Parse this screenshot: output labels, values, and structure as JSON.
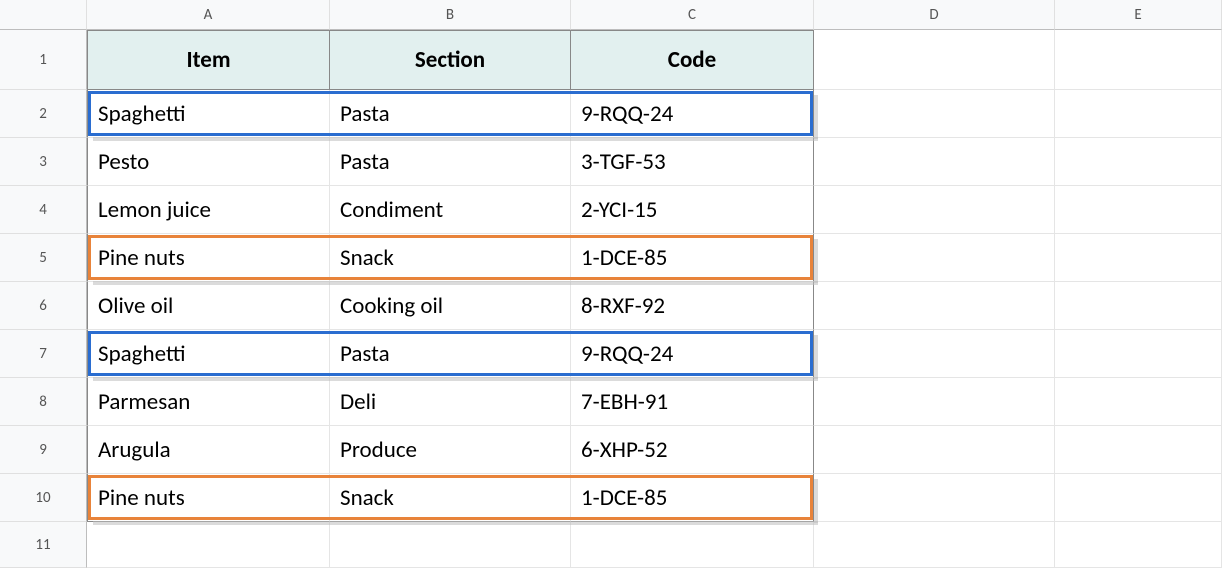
{
  "columns": {
    "letters": [
      "A",
      "B",
      "C",
      "D",
      "E"
    ],
    "widths": [
      243,
      241,
      243,
      241,
      167
    ]
  },
  "row_height_header": 60,
  "row_height_data": 48,
  "row_height_empty": 46,
  "row_count": 11,
  "table": {
    "headers": [
      "Item",
      "Section",
      "Code"
    ],
    "rows": [
      {
        "item": "Spaghetti",
        "section": "Pasta",
        "code": "9-RQQ-24"
      },
      {
        "item": "Pesto",
        "section": "Pasta",
        "code": "3-TGF-53"
      },
      {
        "item": "Lemon juice",
        "section": "Condiment",
        "code": "2-YCI-15"
      },
      {
        "item": "Pine nuts",
        "section": "Snack",
        "code": "1-DCE-85"
      },
      {
        "item": "Olive oil",
        "section": "Cooking oil",
        "code": "8-RXF-92"
      },
      {
        "item": "Spaghetti",
        "section": "Pasta",
        "code": "9-RQQ-24"
      },
      {
        "item": "Parmesan",
        "section": "Deli",
        "code": "7-EBH-91"
      },
      {
        "item": "Arugula",
        "section": "Produce",
        "code": "6-XHP-52"
      },
      {
        "item": "Pine nuts",
        "section": "Snack",
        "code": "1-DCE-85"
      }
    ]
  },
  "highlights": [
    {
      "row_index": 0,
      "color": "#2a6dd0",
      "shadow": true
    },
    {
      "row_index": 3,
      "color": "#e8833a",
      "shadow": true
    },
    {
      "row_index": 5,
      "color": "#2a6dd0",
      "shadow": true
    },
    {
      "row_index": 8,
      "color": "#e8833a",
      "shadow": true
    }
  ]
}
